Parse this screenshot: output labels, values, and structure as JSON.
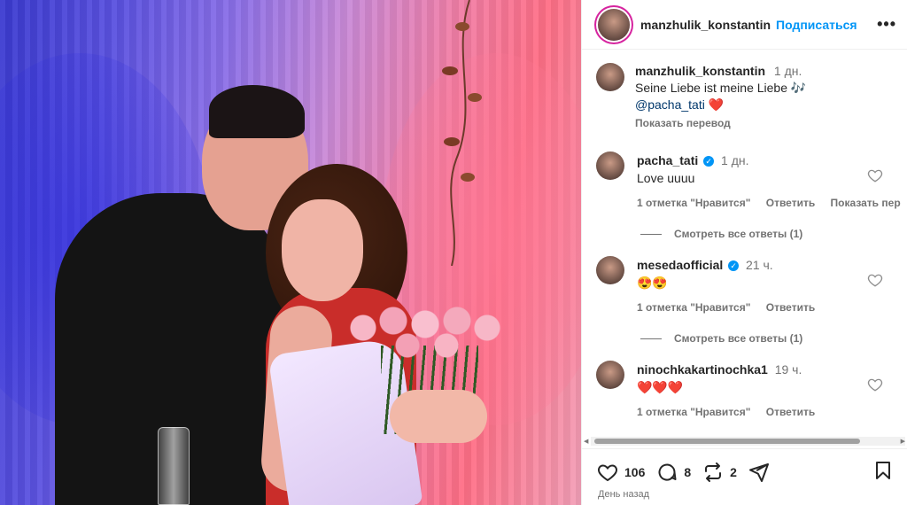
{
  "header": {
    "username": "manzhulik_konstantin",
    "follow_label": "Подписаться",
    "more_label": "•••"
  },
  "caption": {
    "username": "manzhulik_konstantin",
    "time": "1 дн.",
    "text": "Seine Liebe ist meine Liebe",
    "music_emoji": "🎶",
    "mention": "@pacha_tati",
    "heart_emoji": "❤️",
    "translate_label": "Показать перевод"
  },
  "comments": [
    {
      "username": "pacha_tati",
      "verified": true,
      "time": "1 дн.",
      "text": "Love uuuu",
      "likes_label": "1 отметка \"Нравится\"",
      "reply_label": "Ответить",
      "translate_label": "Показать пер",
      "replies_label": "Смотреть все ответы (1)"
    },
    {
      "username": "mesedaofficial",
      "verified": true,
      "time": "21 ч.",
      "text": "😍😍",
      "likes_label": "1 отметка \"Нравится\"",
      "reply_label": "Ответить",
      "replies_label": "Смотреть все ответы (1)"
    },
    {
      "username": "ninochkakartinochka1",
      "verified": false,
      "time": "19 ч.",
      "text": "❤️❤️❤️",
      "likes_label": "1 отметка \"Нравится\"",
      "reply_label": "Ответить"
    }
  ],
  "actions": {
    "likes_count": "106",
    "comments_count": "8",
    "reposts_count": "2",
    "icons": [
      "heart-icon",
      "comment-icon",
      "repost-icon",
      "share-icon",
      "bookmark-icon"
    ]
  },
  "post_date": "День назад",
  "colors": {
    "accent_blue": "#0095f6",
    "text": "#262626",
    "muted": "#737373",
    "mention": "#00376b"
  }
}
